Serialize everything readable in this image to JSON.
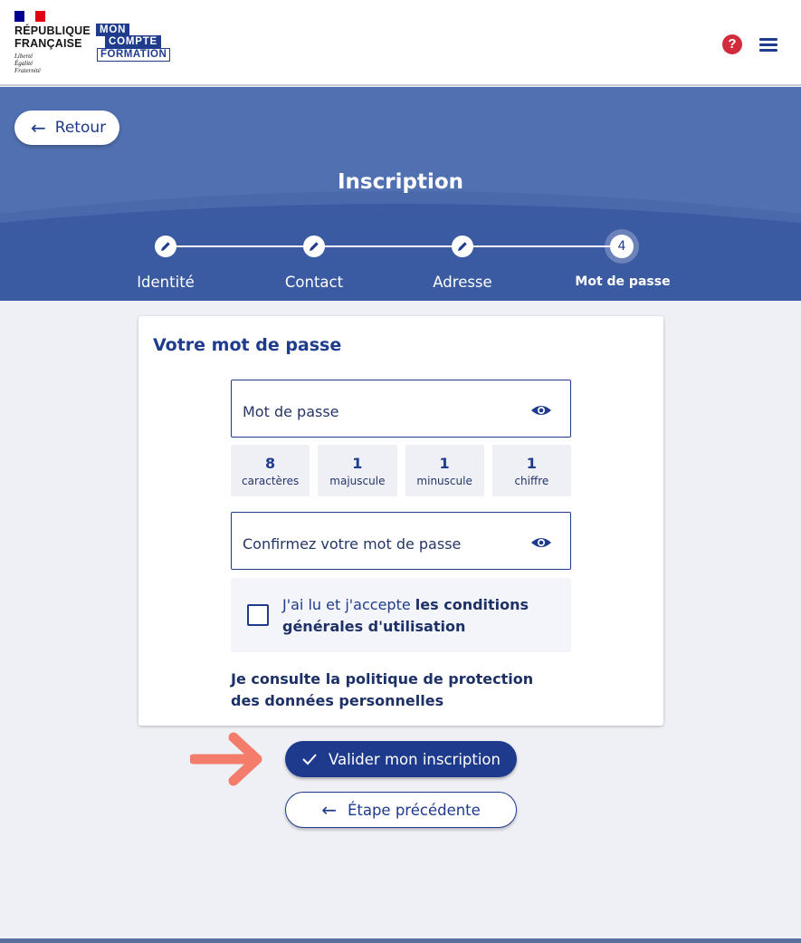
{
  "header": {
    "republique_line1": "RÉPUBLIQUE",
    "republique_line2": "FRANÇAISE",
    "motto": [
      "Liberté",
      "Égalité",
      "Fraternité"
    ],
    "logo_line1": "MON",
    "logo_line2": "COMPTE",
    "logo_line3": "FORMATION",
    "help_icon": "question-circle",
    "menu_icon": "hamburger-menu",
    "help_glyph": "?"
  },
  "hero": {
    "back_label": "Retour",
    "title": "Inscription",
    "steps": [
      {
        "label": "Identité",
        "state": "done",
        "icon": "pencil"
      },
      {
        "label": "Contact",
        "state": "done",
        "icon": "pencil"
      },
      {
        "label": "Adresse",
        "state": "done",
        "icon": "pencil"
      },
      {
        "label": "Mot de passe",
        "state": "current",
        "number": "4"
      }
    ]
  },
  "form": {
    "title": "Votre mot de passe",
    "password_label": "Mot de passe",
    "rules": [
      {
        "value": "8",
        "text": "caractères"
      },
      {
        "value": "1",
        "text": "majuscule"
      },
      {
        "value": "1",
        "text": "minuscule"
      },
      {
        "value": "1",
        "text": "chiffre"
      }
    ],
    "confirm_label": "Confirmez votre mot de passe",
    "terms_prefix": "J'ai lu et j'accepte ",
    "terms_link": "les conditions générales d'utilisation",
    "policy_link": "Je consulte la politique de protection des données personnelles"
  },
  "actions": {
    "submit_label": "Valider mon inscription",
    "previous_label": "Étape précédente"
  },
  "colors": {
    "primary": "#1e3a8d",
    "hero": "#5170b1",
    "pointer": "#f47c6b",
    "help": "#d22b3b"
  }
}
